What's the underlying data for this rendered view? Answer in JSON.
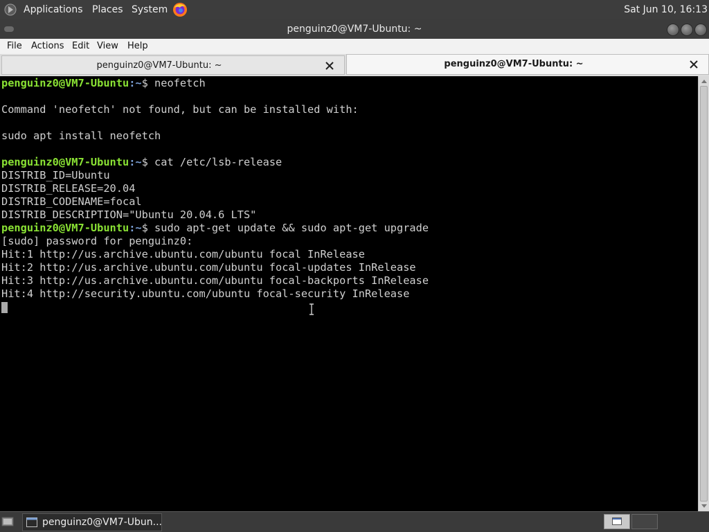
{
  "top_panel": {
    "applications": "Applications",
    "places": "Places",
    "system": "System",
    "clock": "Sat Jun 10, 16:13"
  },
  "window": {
    "title": "penguinz0@VM7-Ubuntu: ~"
  },
  "menubar": {
    "file": "File",
    "actions": "Actions",
    "edit": "Edit",
    "view": "View",
    "help": "Help"
  },
  "tabs": [
    {
      "label": "penguinz0@VM7-Ubuntu: ~",
      "active": false
    },
    {
      "label": "penguinz0@VM7-Ubuntu: ~",
      "active": true
    }
  ],
  "terminal": {
    "prompt_user": "penguinz0@VM7-Ubuntu",
    "prompt_path": ":~",
    "lines": [
      {
        "type": "cmd",
        "cmd": "$ neofetch"
      },
      {
        "type": "out",
        "text": ""
      },
      {
        "type": "out",
        "text": "Command 'neofetch' not found, but can be installed with:"
      },
      {
        "type": "out",
        "text": ""
      },
      {
        "type": "out",
        "text": "sudo apt install neofetch"
      },
      {
        "type": "out",
        "text": ""
      },
      {
        "type": "cmd",
        "cmd": "$ cat /etc/lsb-release"
      },
      {
        "type": "out",
        "text": "DISTRIB_ID=Ubuntu"
      },
      {
        "type": "out",
        "text": "DISTRIB_RELEASE=20.04"
      },
      {
        "type": "out",
        "text": "DISTRIB_CODENAME=focal"
      },
      {
        "type": "out",
        "text": "DISTRIB_DESCRIPTION=\"Ubuntu 20.04.6 LTS\""
      },
      {
        "type": "cmd",
        "cmd": "$ sudo apt-get update && sudo apt-get upgrade"
      },
      {
        "type": "out",
        "text": "[sudo] password for penguinz0:"
      },
      {
        "type": "out",
        "text": "Hit:1 http://us.archive.ubuntu.com/ubuntu focal InRelease"
      },
      {
        "type": "out",
        "text": "Hit:2 http://us.archive.ubuntu.com/ubuntu focal-updates InRelease"
      },
      {
        "type": "out",
        "text": "Hit:3 http://us.archive.ubuntu.com/ubuntu focal-backports InRelease"
      },
      {
        "type": "out",
        "text": "Hit:4 http://security.ubuntu.com/ubuntu focal-security InRelease"
      },
      {
        "type": "cursor"
      }
    ]
  },
  "taskbar": {
    "task_label": "penguinz0@VM7-Ubun..."
  },
  "colors": {
    "prompt_user": "#8ae234",
    "prompt_path": "#7a9fd4",
    "terminal_bg": "#000000",
    "terminal_fg": "#d0d0d0"
  },
  "icons": {
    "apps": "mate-logo-icon",
    "browser": "firefox-icon",
    "tab_close": "close-icon",
    "task": "terminal-window-icon"
  }
}
